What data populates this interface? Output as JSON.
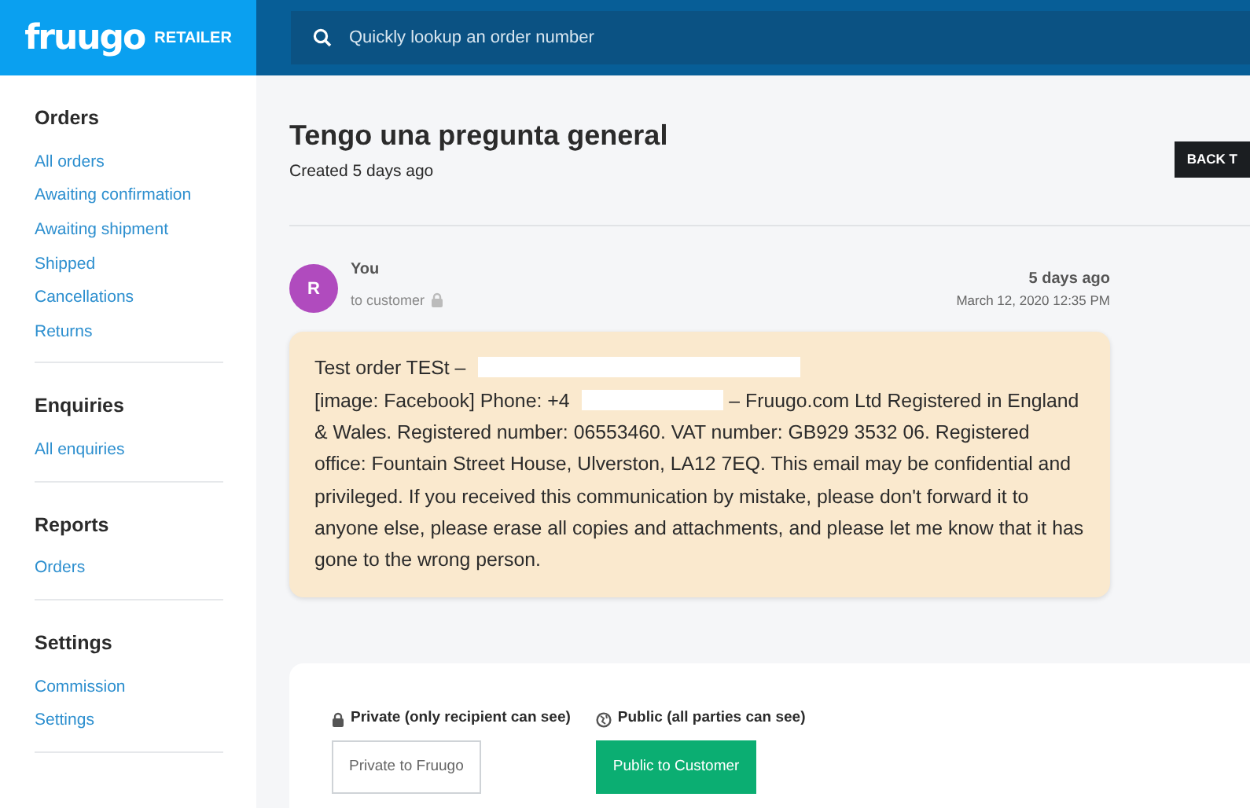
{
  "brand": {
    "logo": "fruugo",
    "product": "RETAILER"
  },
  "search": {
    "placeholder": "Quickly lookup an order number"
  },
  "sidebar": [
    {
      "heading": "Orders",
      "items": [
        {
          "label": "All orders"
        },
        {
          "label": "Awaiting confirmation"
        },
        {
          "label": "Awaiting shipment"
        },
        {
          "label": "Shipped"
        },
        {
          "label": "Cancellations"
        },
        {
          "label": "Returns"
        }
      ]
    },
    {
      "heading": "Enquiries",
      "items": [
        {
          "label": "All enquiries"
        }
      ]
    },
    {
      "heading": "Reports",
      "items": [
        {
          "label": "Orders"
        }
      ]
    },
    {
      "heading": "Settings",
      "items": [
        {
          "label": "Commission"
        },
        {
          "label": "Settings"
        }
      ]
    }
  ],
  "enquiry": {
    "title": "Tengo una pregunta general",
    "created": "Created 5 days ago",
    "back_button": "BACK T"
  },
  "message": {
    "avatar": "R",
    "sender": "You",
    "recipient": "to customer",
    "private": true,
    "age": "5 days ago",
    "timestamp": "March 12, 2020 12:35 PM",
    "body": [
      {
        "kind": "text",
        "text": "Test order TESt –"
      },
      {
        "kind": "redacted"
      },
      {
        "kind": "text",
        "text": "[image: Facebook] Phone: +4"
      },
      {
        "kind": "redacted"
      },
      {
        "kind": "text",
        "text": "–      Fruugo.com Ltd Registered in England & Wales. Registered number: 06553460. VAT number: GB929 3532 06. Registered office: Fountain Street House, Ulverston, LA12 7EQ. This email may be confidential and privileged. If you received this communication by mistake, please don't forward it to anyone else, please erase all copies and attachments, and please let me know that it has gone to the wrong person."
      }
    ]
  },
  "reply": {
    "options": [
      {
        "kind": "private",
        "label": "Private (only recipient can see)",
        "button": "Private to Fruugo",
        "selected": false
      },
      {
        "kind": "public",
        "label": "Public (all parties can see)",
        "button": "Public to Customer",
        "selected": true
      }
    ]
  }
}
